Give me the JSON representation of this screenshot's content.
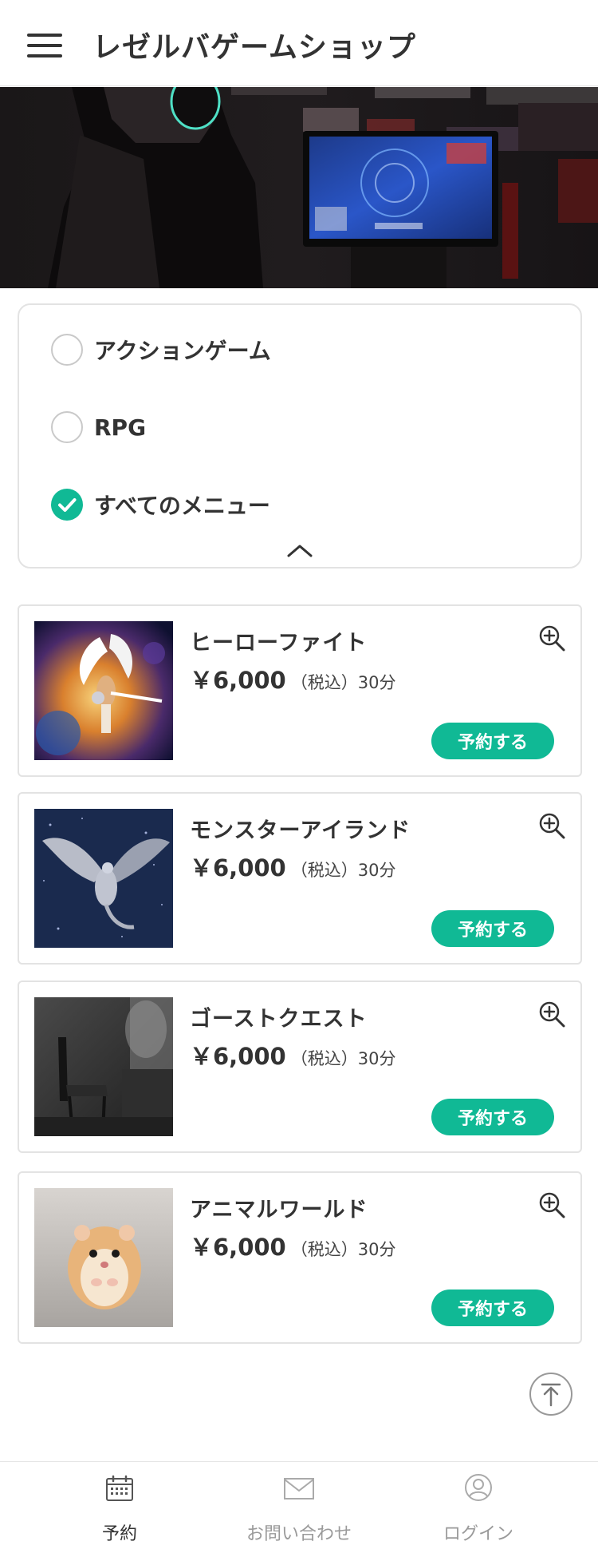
{
  "header": {
    "title": "レゼルバゲームショップ",
    "menu_icon": "hamburger-menu-icon"
  },
  "categories": {
    "options": [
      {
        "label": "アクションゲーム",
        "selected": false
      },
      {
        "label": "RPG",
        "selected": false
      },
      {
        "label": "すべてのメニュー",
        "selected": true
      }
    ],
    "collapse_icon": "chevron-up-icon"
  },
  "products": [
    {
      "name": "ヒーローファイト",
      "price": "￥6,000",
      "tax": "（税込）",
      "duration": "30分",
      "button": "予約する"
    },
    {
      "name": "モンスターアイランド",
      "price": "￥6,000",
      "tax": "（税込）",
      "duration": "30分",
      "button": "予約する"
    },
    {
      "name": "ゴーストクエスト",
      "price": "￥6,000",
      "tax": "（税込）",
      "duration": "30分",
      "button": "予約する"
    },
    {
      "name": "アニマルワールド",
      "price": "￥6,000",
      "tax": "（税込）",
      "duration": "30分",
      "button": "予約する"
    }
  ],
  "bottom_nav": {
    "items": [
      {
        "label": "予約",
        "icon": "calendar-icon",
        "active": true
      },
      {
        "label": "お問い合わせ",
        "icon": "mail-icon",
        "active": false
      },
      {
        "label": "ログイン",
        "icon": "user-icon",
        "active": false
      }
    ]
  },
  "colors": {
    "accent": "#10b995",
    "text": "#333333",
    "muted": "#9a9a9a",
    "border": "#e3e3e3"
  }
}
